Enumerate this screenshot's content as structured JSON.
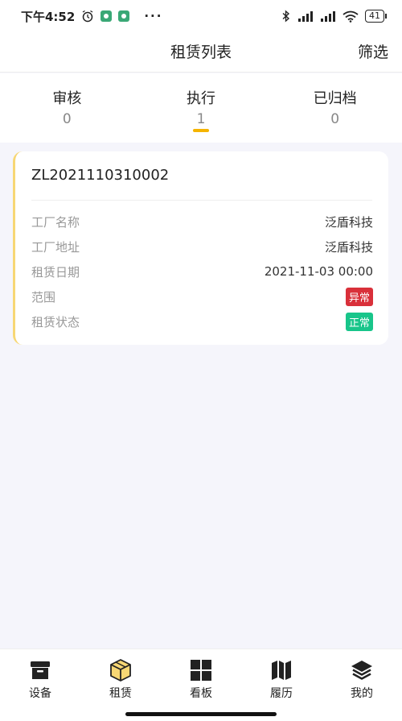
{
  "status_bar": {
    "time": "下午4:52",
    "dots": "···",
    "battery": "41"
  },
  "nav": {
    "title": "租赁列表",
    "filter_label": "筛选"
  },
  "tabs": [
    {
      "label": "审核",
      "count": "0"
    },
    {
      "label": "执行",
      "count": "1"
    },
    {
      "label": "已归档",
      "count": "0"
    }
  ],
  "active_tab": "执行",
  "card": {
    "id": "ZL2021110310002",
    "rows": [
      {
        "label": "工厂名称",
        "value": "泛盾科技"
      },
      {
        "label": "工厂地址",
        "value": "泛盾科技"
      },
      {
        "label": "租赁日期",
        "value": "2021-11-03 00:00"
      },
      {
        "label": "范围",
        "value": "异常"
      },
      {
        "label": "租赁状态",
        "value": "正常"
      }
    ]
  },
  "bottom_nav": [
    {
      "label": "设备",
      "icon": "box-icon"
    },
    {
      "label": "租赁",
      "icon": "cube-icon"
    },
    {
      "label": "看板",
      "icon": "grid-icon"
    },
    {
      "label": "履历",
      "icon": "map-icon"
    },
    {
      "label": "我的",
      "icon": "layers-icon"
    }
  ],
  "colors": {
    "accent": "#f5b400",
    "badge_red": "#d9303a",
    "badge_green": "#18c58a",
    "active_icon_fill": "#f7d774"
  }
}
